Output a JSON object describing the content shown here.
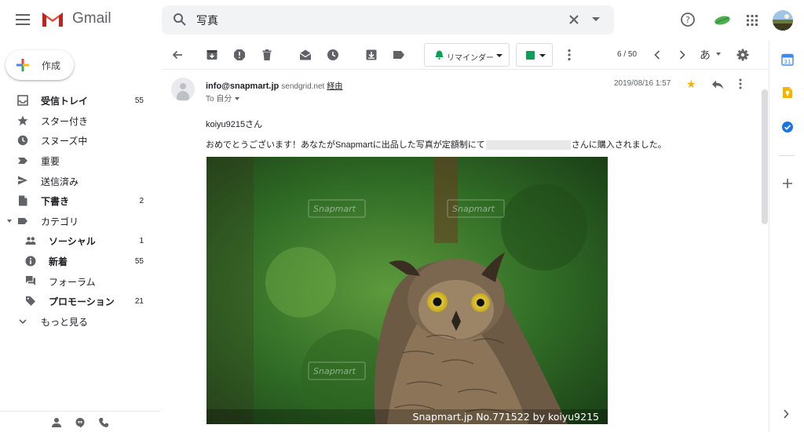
{
  "app": {
    "logo_text": "Gmail"
  },
  "search": {
    "query": "写真"
  },
  "sidebar": {
    "compose_label": "作成",
    "items": [
      {
        "label": "受信トレイ",
        "count": "55",
        "icon": "inbox-icon",
        "bold": true
      },
      {
        "label": "スター付き",
        "count": "",
        "icon": "star-icon",
        "bold": false
      },
      {
        "label": "スヌーズ中",
        "count": "",
        "icon": "clock-icon",
        "bold": false
      },
      {
        "label": "重要",
        "count": "",
        "icon": "important-icon",
        "bold": false
      },
      {
        "label": "送信済み",
        "count": "",
        "icon": "send-icon",
        "bold": false
      },
      {
        "label": "下書き",
        "count": "2",
        "icon": "draft-icon",
        "bold": true
      },
      {
        "label": "カテゴリ",
        "count": "",
        "icon": "label-icon",
        "bold": false
      },
      {
        "label": "ソーシャル",
        "count": "1",
        "icon": "people-icon",
        "bold": true
      },
      {
        "label": "新着",
        "count": "55",
        "icon": "info-icon",
        "bold": true
      },
      {
        "label": "フォーラム",
        "count": "",
        "icon": "forum-icon",
        "bold": false
      },
      {
        "label": "プロモーション",
        "count": "21",
        "icon": "tag-icon",
        "bold": true
      },
      {
        "label": "もっと見る",
        "count": "",
        "icon": "chevron-down-icon",
        "bold": false
      }
    ]
  },
  "toolbar": {
    "reminder_label": "リマインダー",
    "pager": "6 / 50",
    "input_language": "あ"
  },
  "message": {
    "sender_email": "info@snapmart.jp",
    "via_domain": "sendgrid.net",
    "via_label": "経由",
    "to_line": "To 自分",
    "date": "2019/08/16 1:57",
    "greeting": "koiyu9215さん",
    "body_part1": "おめでとうございます！あなたがSnapmartに出品した",
    "body_highlight": "写真",
    "body_part2": "が定額制にて",
    "body_part3": "さんに購入されました。",
    "photo_watermark": "Snapmart",
    "photo_caption": "Snapmart.jp No.771522 by koiyu9215"
  },
  "rail": {
    "calendar_label": "31"
  },
  "colors": {
    "star": "#f4b400",
    "keep": "#f4b400",
    "tasks": "#1a73e8",
    "gmail_red": "#ea4335"
  }
}
